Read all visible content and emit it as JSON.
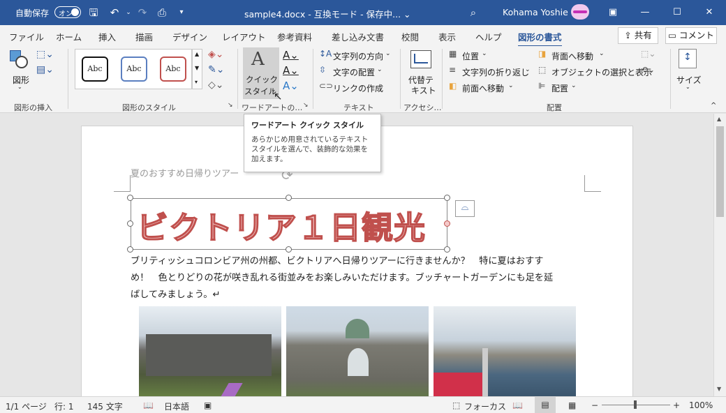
{
  "titlebar": {
    "autosave_label": "自動保存",
    "autosave_state": "オン",
    "document_title": "sample4.docx  -  互換モード  -  保存中...  ⌄",
    "user_name": "Kohama Yoshie"
  },
  "tabs": [
    "ファイル",
    "ホーム",
    "挿入",
    "描画",
    "デザイン",
    "レイアウト",
    "参考資料",
    "差し込み文書",
    "校閲",
    "表示",
    "ヘルプ",
    "図形の書式"
  ],
  "share_label": "共有",
  "comment_label": "コメント",
  "ribbon": {
    "insert_shapes": {
      "shapes_label": "図形",
      "group_label": "図形の挿入"
    },
    "shape_styles": {
      "styles": [
        "Abc",
        "Abc",
        "Abc"
      ],
      "group_label": "図形のスタイル"
    },
    "wordart": {
      "quick_style_label_1": "クイック",
      "quick_style_label_2": "スタイル",
      "group_label": "ワードアートの…"
    },
    "text": {
      "direction": "文字列の方向",
      "align": "文字の配置",
      "link": "リンクの作成",
      "group_label": "テキスト"
    },
    "accessibility": {
      "alt_text_1": "代替テ",
      "alt_text_2": "キスト",
      "group_label": "アクセシ…"
    },
    "arrange": {
      "position": "位置",
      "wrap": "文字列の折り返し",
      "bring_forward": "前面へ移動",
      "send_backward": "背面へ移動",
      "selection_pane": "オブジェクトの選択と表示",
      "align": "配置",
      "group_label": "配置"
    },
    "size": {
      "label": "サイズ"
    }
  },
  "tooltip": {
    "title": "ワードアート クイック スタイル",
    "body": "あらかじめ用意されているテキスト スタイルを選んで、装飾的な効果を加えます。"
  },
  "document": {
    "header_text": "夏のおすすめ日帰りツアー",
    "wordart_text": "ビクトリア１日観光",
    "paragraph_line1": "ブリティッシュコロンビア州の州都、ビクトリアへ日帰りツアーに行きませんか？　特に夏はおすす",
    "paragraph_line2": "め！　色とりどりの花が咲き乱れる街並みをお楽しみいただけます。ブッチャートガーデンにも足を延",
    "paragraph_line3": "ばしてみましょう。↵"
  },
  "statusbar": {
    "page": "1/1 ページ",
    "line": "行: 1",
    "chars": "145 文字",
    "language": "日本語",
    "focus": "フォーカス",
    "zoom": "100%"
  },
  "colors": {
    "titlebar": "#2b579a",
    "wordart_fill": "#f4c9c9",
    "wordart_outline": "#c0504d",
    "accent": "#2b579a"
  }
}
